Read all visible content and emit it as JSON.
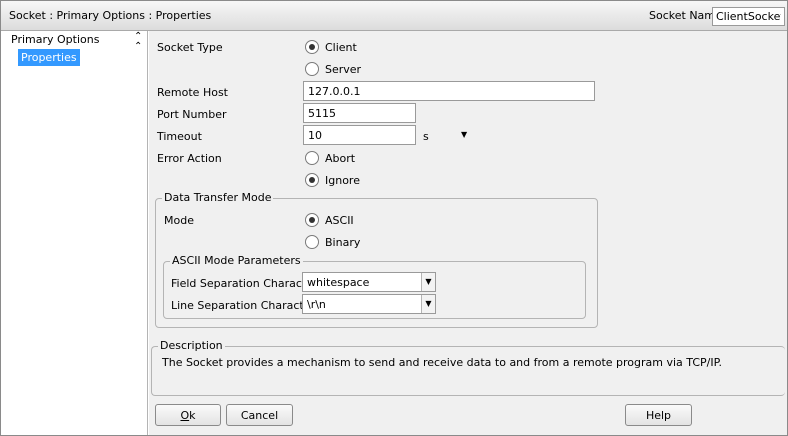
{
  "window": {
    "title": "Socket : Primary Options : Properties",
    "socket_name_label": "Socket Name",
    "socket_name_value": "ClientSocket"
  },
  "tree": {
    "parent": "Primary Options",
    "child": "Properties",
    "collapse_icon": "double-chevron-up-icon"
  },
  "form": {
    "socket_type_label": "Socket Type",
    "socket_type_options": [
      {
        "label": "Client",
        "checked": true
      },
      {
        "label": "Server",
        "checked": false
      }
    ],
    "remote_host_label": "Remote Host",
    "remote_host_value": "127.0.0.1",
    "port_label": "Port Number",
    "port_value": "5115",
    "timeout_label": "Timeout",
    "timeout_value": "10",
    "timeout_unit": "s",
    "error_action_label": "Error Action",
    "error_action_options": [
      {
        "label": "Abort",
        "checked": false
      },
      {
        "label": "Ignore",
        "checked": true
      }
    ]
  },
  "data_transfer": {
    "group_title": "Data Transfer Mode",
    "mode_label": "Mode",
    "mode_options": [
      {
        "label": "ASCII",
        "checked": true
      },
      {
        "label": "Binary",
        "checked": false
      }
    ],
    "ascii_group_title": "ASCII Mode Parameters",
    "field_sep_label": "Field Separation Characters",
    "field_sep_value": "whitespace",
    "line_sep_label": "Line Separation Characters",
    "line_sep_value": "\\r\\n"
  },
  "description": {
    "title": "Description",
    "text": "The Socket provides a mechanism to send and receive data to and from a remote program via TCP/IP."
  },
  "buttons": {
    "ok": "Ok",
    "cancel": "Cancel",
    "help": "Help"
  }
}
